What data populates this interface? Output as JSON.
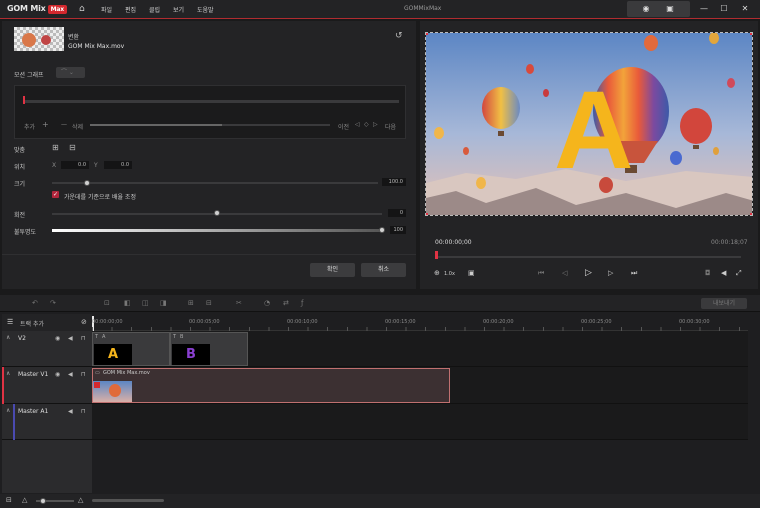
{
  "titlebar": {
    "logo": "GOM Mix",
    "logo_badge": "Max",
    "menu": [
      "파일",
      "편집",
      "클립",
      "보기",
      "도움말"
    ],
    "window_title": "GOMMixMax",
    "accent": "#d4282e"
  },
  "edit_panel": {
    "section_label": "변환",
    "file_name": "GOM Mix Max.mov",
    "motion_graph_label": "모션 그래프",
    "add_label": "추가",
    "delete_label": "삭제",
    "prev_label": "이전",
    "next_label": "다음",
    "align_label": "맞춤",
    "position_label": "위치",
    "x_label": "X",
    "x_value": "0.0",
    "y_label": "Y",
    "y_value": "0.0",
    "size_label": "크기",
    "size_value": "100.0",
    "aspect_label": "가운데를 기준으로 배율 조정",
    "aspect_checked": true,
    "rotation_label": "회전",
    "rotation_value": "0",
    "opacity_label": "불투명도",
    "opacity_value": "100",
    "ok_label": "확인",
    "cancel_label": "취소"
  },
  "preview": {
    "overlay_letter": "A",
    "current_time": "00:00:00;00",
    "total_time": "00:00:18;07",
    "zoom": "1.0x"
  },
  "timeline": {
    "track_add_label": "트랙 추가",
    "export_label": "내보내기",
    "ruler": [
      "00:00:00;00",
      "00:00:05;00",
      "00:00:10;00",
      "00:00:15;00",
      "00:00:20;00",
      "00:00:25;00",
      "00:00:30;00",
      "00:00:35;00"
    ],
    "tracks": [
      {
        "name": "V2"
      },
      {
        "name": "Master V1"
      },
      {
        "name": "Master A1"
      }
    ],
    "text_clips": [
      {
        "label": "A",
        "letter": "A",
        "letter_color": "#f5b51c"
      },
      {
        "label": "B",
        "letter": "B",
        "letter_color": "#8a3fd1"
      }
    ],
    "video_clip": {
      "label": "GOM Mix Max.mov"
    }
  }
}
